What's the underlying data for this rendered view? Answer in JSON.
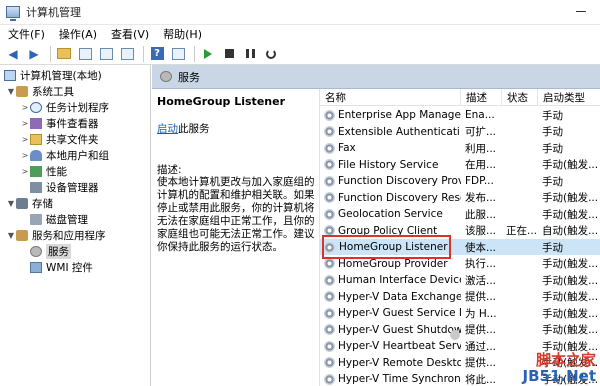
{
  "window": {
    "title": "计算机管理"
  },
  "menu": [
    {
      "label": "文件(F)"
    },
    {
      "label": "操作(A)"
    },
    {
      "label": "查看(V)"
    },
    {
      "label": "帮助(H)"
    }
  ],
  "toolbar": {
    "buttons": [
      "back-arrow-icon",
      "forward-arrow-icon",
      "up-folder-icon",
      "show-hide-tree-icon",
      "export-icon",
      "properties-icon",
      "help-icon",
      "play-icon",
      "stop-icon",
      "pause-icon",
      "restart-icon"
    ]
  },
  "tree": {
    "root": "计算机管理(本地)",
    "items": [
      {
        "label": "系统工具",
        "icon": "tools-icon"
      },
      {
        "label": "任务计划程序",
        "icon": "clock-icon"
      },
      {
        "label": "事件查看器",
        "icon": "event-log-icon"
      },
      {
        "label": "共享文件夹",
        "icon": "folder-icon"
      },
      {
        "label": "本地用户和组",
        "icon": "users-icon"
      },
      {
        "label": "性能",
        "icon": "performance-icon"
      },
      {
        "label": "设备管理器",
        "icon": "device-manager-icon"
      },
      {
        "label": "存储",
        "icon": "storage-icon"
      },
      {
        "label": "磁盘管理",
        "icon": "disk-icon"
      },
      {
        "label": "服务和应用程序",
        "icon": "services-apps-icon"
      },
      {
        "label": "服务",
        "icon": "services-icon"
      },
      {
        "label": "WMI 控件",
        "icon": "wmi-icon"
      }
    ]
  },
  "services_header": {
    "label": "服务"
  },
  "detail": {
    "title": "HomeGroup Listener",
    "action_link": "启动",
    "action_rest": "此服务",
    "desc_heading": "描述:",
    "desc_body": "使本地计算机更改与加入家庭组的计算机的配置和维护相关联。如果停止或禁用此服务，你的计算机将无法在家庭组中正常工作，且你的家庭组也可能无法正常工作。建议你保持此服务的运行状态。"
  },
  "table": {
    "headers": {
      "name": "名称",
      "desc": "描述",
      "status": "状态",
      "start": "启动类型"
    },
    "rows": [
      {
        "name": "Enterprise App Manage...",
        "desc": "Ena...",
        "status": "",
        "start": "手动"
      },
      {
        "name": "Extensible Authenticati...",
        "desc": "可扩...",
        "status": "",
        "start": "手动"
      },
      {
        "name": "Fax",
        "desc": "利用...",
        "status": "",
        "start": "手动"
      },
      {
        "name": "File History Service",
        "desc": "在用...",
        "status": "",
        "start": "手动(触发..."
      },
      {
        "name": "Function Discovery Provi...",
        "desc": "FDP...",
        "status": "",
        "start": "手动"
      },
      {
        "name": "Function Discovery Reso...",
        "desc": "发布...",
        "status": "",
        "start": "手动(触发..."
      },
      {
        "name": "Geolocation Service",
        "desc": "此服...",
        "status": "",
        "start": "手动(触发..."
      },
      {
        "name": "Group Policy Client",
        "desc": "该服...",
        "status": "正在...",
        "start": "自动(触发..."
      },
      {
        "name": "HomeGroup Listener",
        "desc": "使本...",
        "status": "",
        "start": "手动"
      },
      {
        "name": "HomeGroup Provider",
        "desc": "执行...",
        "status": "",
        "start": "手动(触发..."
      },
      {
        "name": "Human Interface Device ...",
        "desc": "激活...",
        "status": "",
        "start": "手动(触发..."
      },
      {
        "name": "Hyper-V Data Exchange ...",
        "desc": "提供...",
        "status": "",
        "start": "手动(触发..."
      },
      {
        "name": "Hyper-V Guest Service In...",
        "desc": "为 H...",
        "status": "",
        "start": "手动(触发..."
      },
      {
        "name": "Hyper-V Guest Shutdown...",
        "desc": "提供...",
        "status": "",
        "start": "手动(触发..."
      },
      {
        "name": "Hyper-V Heartbeat Service",
        "desc": "通过...",
        "status": "",
        "start": "手动(触发..."
      },
      {
        "name": "Hyper-V Remote Deskto...",
        "desc": "提供...",
        "status": "",
        "start": "手动(触发..."
      },
      {
        "name": "Hyper-V Time Synchroniz...",
        "desc": "将此...",
        "status": "",
        "start": "手动(触发..."
      }
    ]
  },
  "watermark": {
    "line1": "脚本之家",
    "line2": "JB51.Net"
  },
  "colors": {
    "selection": "#cce4f7",
    "highlight_border": "#d9342a",
    "header_strip": "#c8d6e6",
    "link": "#1a5fb4"
  }
}
